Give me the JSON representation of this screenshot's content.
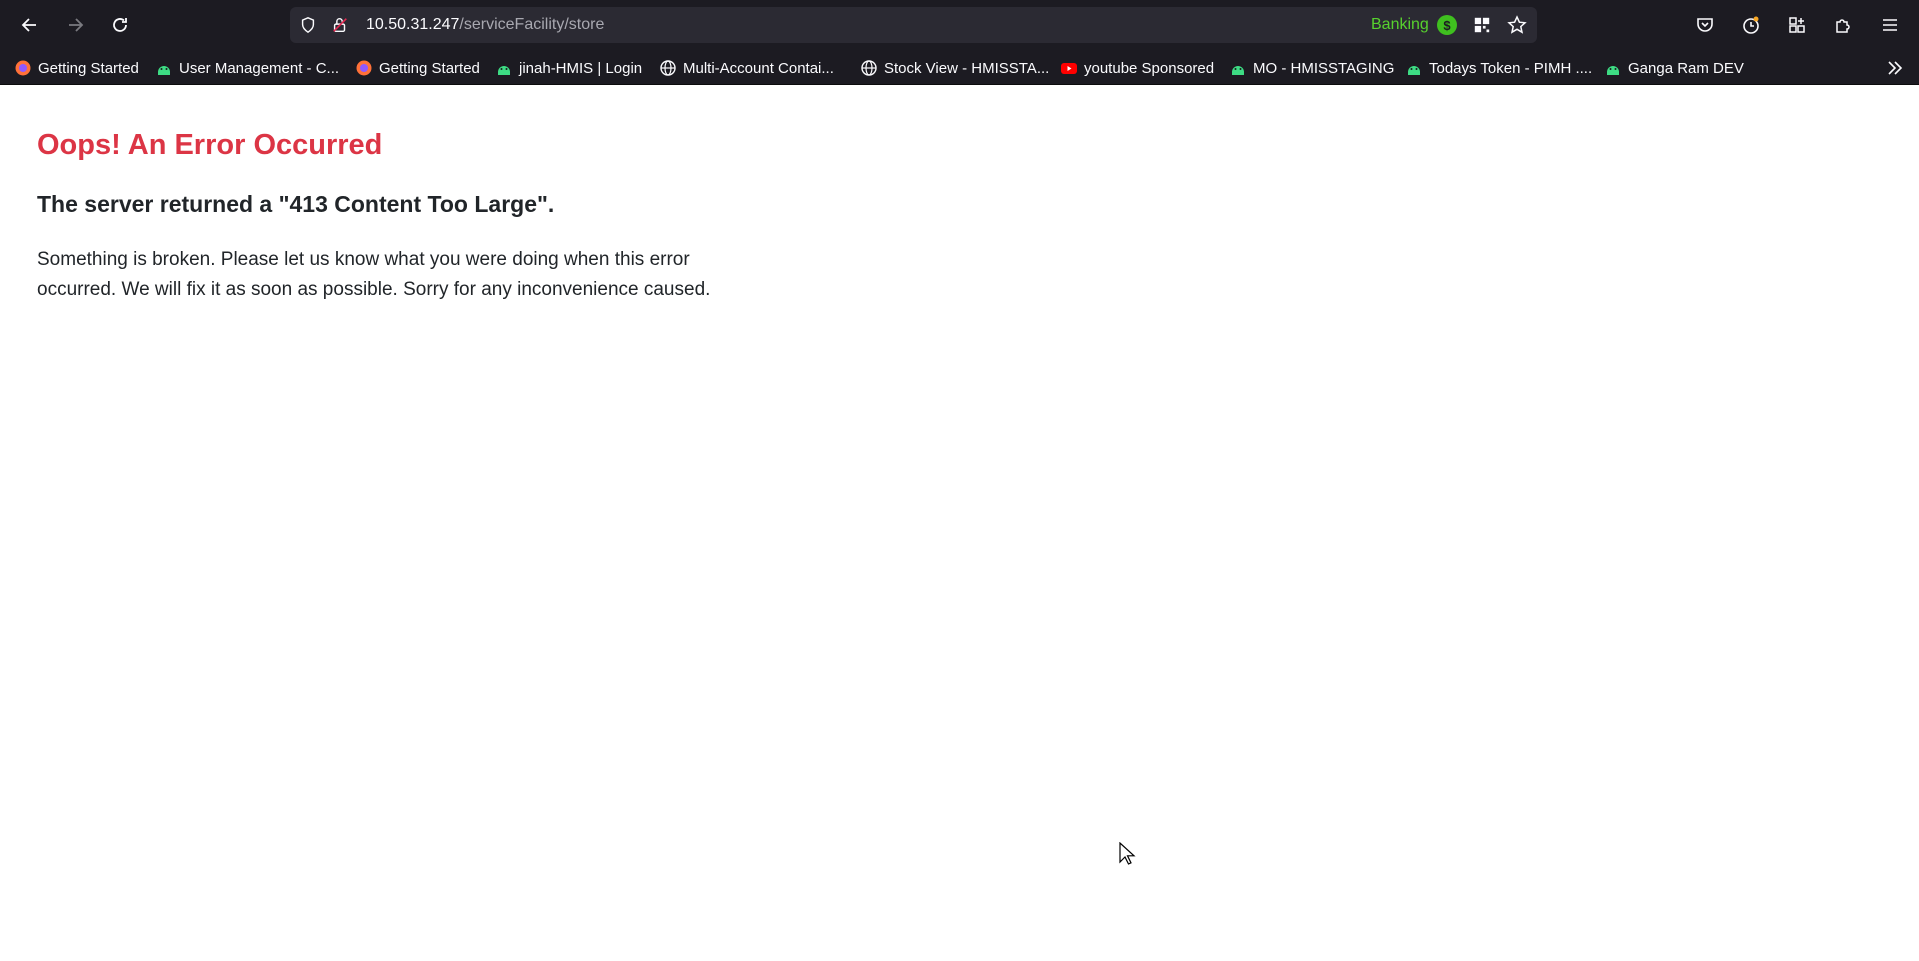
{
  "browser": {
    "url_host": "10.50.31.247",
    "url_path": "/serviceFacility/store",
    "container_name": "Banking",
    "container_badge": "$",
    "colors": {
      "chrome": "#1c1b22",
      "urlbar": "#2b2a33",
      "container": "#57d12e"
    }
  },
  "bookmarks": [
    {
      "label": "Getting Started",
      "icon": "firefox-icon"
    },
    {
      "label": "User Management - C...",
      "icon": "android-icon"
    },
    {
      "label": "Getting Started",
      "icon": "firefox-icon"
    },
    {
      "label": "jinah-HMIS | Login",
      "icon": "android-icon"
    },
    {
      "label": "Multi-Account Contai...",
      "icon": "globe-icon"
    },
    {
      "label": "Stock View - HMISSTA...",
      "icon": "globe-icon"
    },
    {
      "label": "youtube Sponsored",
      "icon": "youtube-icon"
    },
    {
      "label": "MO - HMISSTAGING",
      "icon": "android-icon"
    },
    {
      "label": "Todays Token - PIMH ....",
      "icon": "android-icon"
    },
    {
      "label": "Ganga Ram DEV",
      "icon": "android-icon"
    }
  ],
  "page": {
    "title": "Oops! An Error Occurred",
    "subtitle": "The server returned a \"413 Content Too Large\".",
    "body_line1": "Something is broken. Please let us know what you were doing when this error",
    "body_line2": "occurred. We will fix it as soon as possible. Sorry for any inconvenience caused.",
    "colors": {
      "title": "#dc3545",
      "text": "#212529"
    }
  }
}
